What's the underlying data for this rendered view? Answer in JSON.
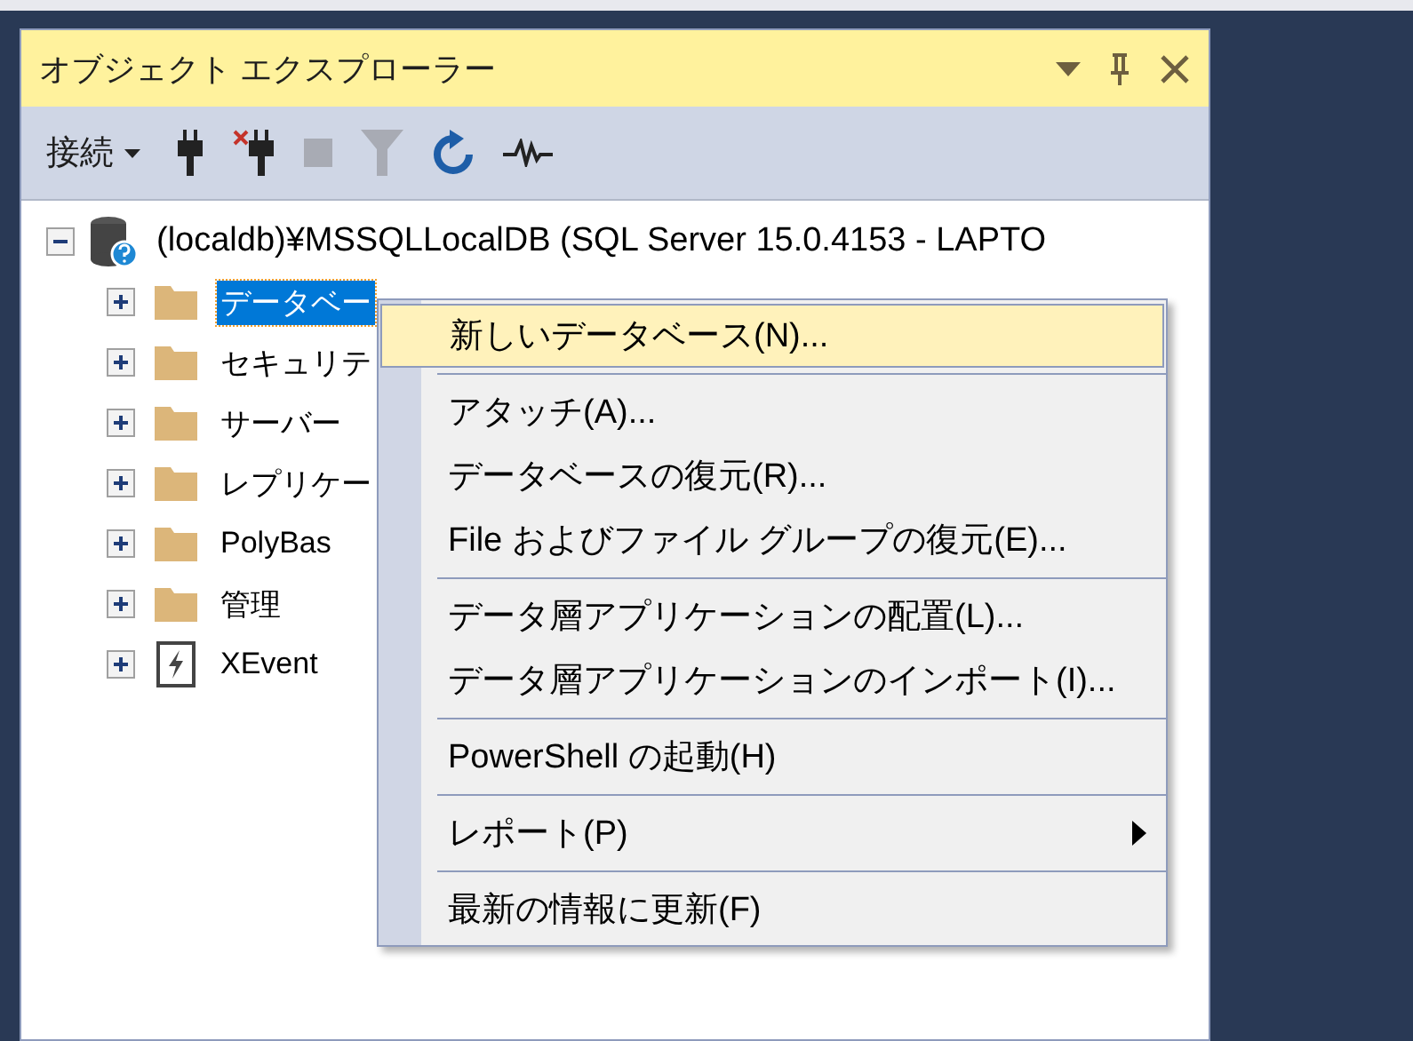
{
  "panel": {
    "title": "オブジェクト エクスプローラー"
  },
  "toolbar": {
    "connect_label": "接続"
  },
  "tree": {
    "label": "(localdb)¥MSSQLLocalDB (SQL Server 15.0.4153 - LAPTO",
    "expanded": true,
    "children": [
      {
        "label": "データベー",
        "kind": "folder",
        "selected": true,
        "expanded": false
      },
      {
        "label": "セキュリテ",
        "kind": "folder",
        "selected": false,
        "expanded": false
      },
      {
        "label": "サーバー",
        "kind": "folder",
        "selected": false,
        "expanded": false
      },
      {
        "label": "レプリケー",
        "kind": "folder",
        "selected": false,
        "expanded": false
      },
      {
        "label": "PolyBas",
        "kind": "folder",
        "selected": false,
        "expanded": false
      },
      {
        "label": "管理",
        "kind": "folder",
        "selected": false,
        "expanded": false
      },
      {
        "label": "XEvent",
        "kind": "xevent",
        "selected": false,
        "expanded": false
      }
    ]
  },
  "context_menu": {
    "groups": [
      [
        {
          "label": "新しいデータベース(N)...",
          "selected": true,
          "submenu": false
        }
      ],
      [
        {
          "label": "アタッチ(A)...",
          "selected": false,
          "submenu": false
        },
        {
          "label": "データベースの復元(R)...",
          "selected": false,
          "submenu": false
        },
        {
          "label": "File およびファイル グループの復元(E)...",
          "selected": false,
          "submenu": false
        }
      ],
      [
        {
          "label": "データ層アプリケーションの配置(L)...",
          "selected": false,
          "submenu": false
        },
        {
          "label": "データ層アプリケーションのインポート(I)...",
          "selected": false,
          "submenu": false
        }
      ],
      [
        {
          "label": "PowerShell の起動(H)",
          "selected": false,
          "submenu": false
        }
      ],
      [
        {
          "label": "レポート(P)",
          "selected": false,
          "submenu": true
        }
      ],
      [
        {
          "label": "最新の情報に更新(F)",
          "selected": false,
          "submenu": false
        }
      ]
    ]
  }
}
